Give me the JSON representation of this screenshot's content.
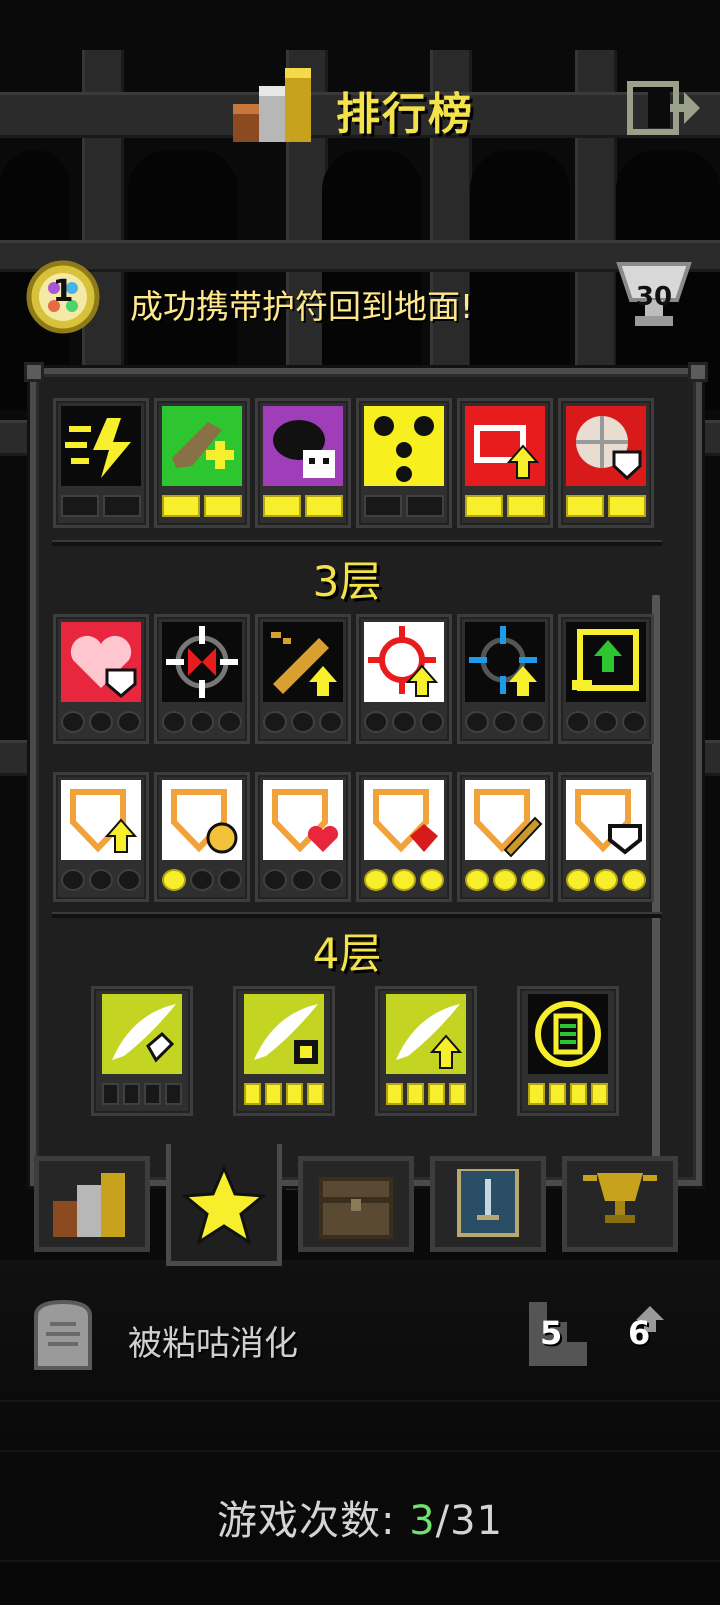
{
  "header": {
    "title": "排行榜"
  },
  "challenge": {
    "amulet_rank": "1",
    "text": "成功携带护符回到地面!",
    "trophy_value": "30"
  },
  "floors": [
    {
      "label": ""
    },
    {
      "label": "3层"
    },
    {
      "label": "4层"
    }
  ],
  "death": {
    "cause": "被粘咕消化",
    "depth": "5",
    "level": "6"
  },
  "games": {
    "label": "游戏次数:",
    "current": "3",
    "total": "/31"
  },
  "tabs": [
    {
      "name": "rankings",
      "active": false
    },
    {
      "name": "badges",
      "active": true
    },
    {
      "name": "journal",
      "active": false
    },
    {
      "name": "challenges",
      "active": false
    },
    {
      "name": "trophies",
      "active": false
    }
  ],
  "colors": {
    "title": "#f3e24a",
    "active_pip": "#f7ef2b",
    "current_count": "#6ee36e"
  }
}
